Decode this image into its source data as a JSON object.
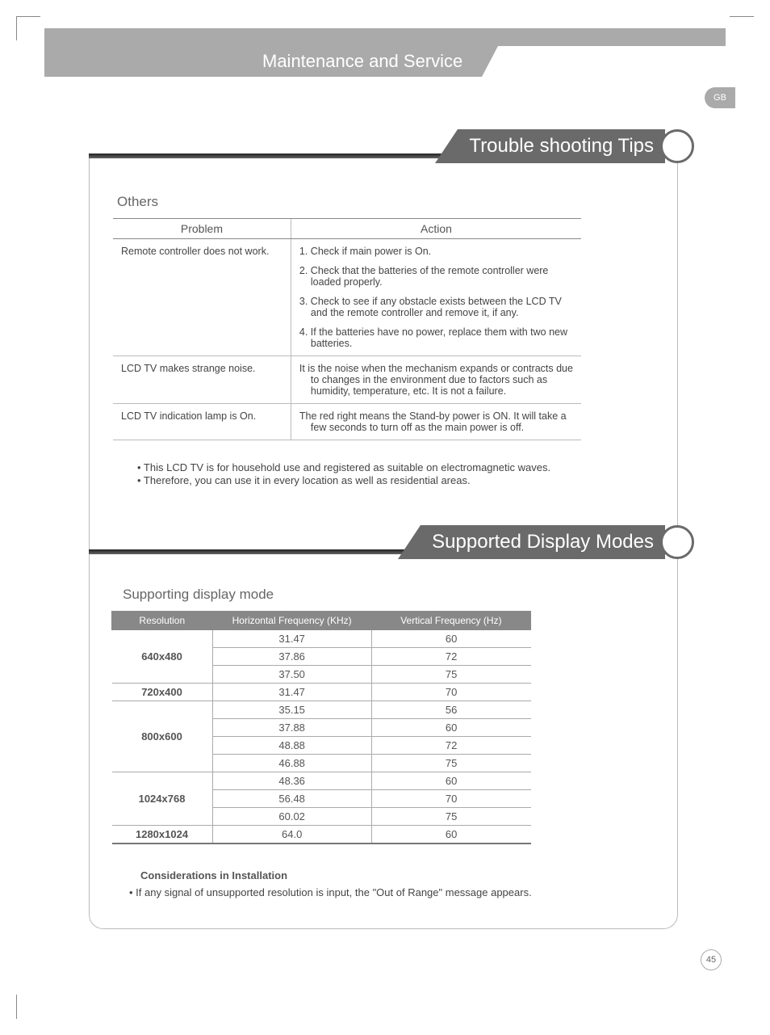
{
  "language_badge": "GB",
  "section_title": "Maintenance and Service",
  "heading1": "Trouble shooting Tips",
  "heading2": "Supported Display Modes",
  "trouble": {
    "subhead": "Others",
    "col_problem": "Problem",
    "col_action": "Action",
    "rows": [
      {
        "problem": "Remote controller does not work.",
        "actions": [
          "1. Check if main power is On.",
          "2. Check that the batteries of the remote controller were loaded properly.",
          "3. Check to see if any obstacle exists between the LCD TV and the remote controller and remove it, if any.",
          "4. If the batteries have no power, replace them with two new batteries."
        ]
      },
      {
        "problem": "LCD TV makes strange noise.",
        "actions": [
          "It is the noise when the mechanism expands or contracts due to changes in the environment due to factors such as humidity, temperature, etc. It is not a failure."
        ]
      },
      {
        "problem": "LCD TV indication lamp is On.",
        "actions": [
          "The red right means the Stand-by power is ON. It will take a few seconds to turn off as the main power is off."
        ]
      }
    ],
    "note1": "• This LCD TV is for household use and registered as suitable on electromagnetic waves.",
    "note2": "• Therefore, you can use it in every location as well as residential areas."
  },
  "modes": {
    "subhead": "Supporting display mode",
    "col_res": "Resolution",
    "col_hf": "Horizontal Frequency (KHz)",
    "col_vf": "Vertical Frequency (Hz)",
    "groups": [
      {
        "res": "640x480",
        "rows": [
          {
            "hf": "31.47",
            "vf": "60"
          },
          {
            "hf": "37.86",
            "vf": "72"
          },
          {
            "hf": "37.50",
            "vf": "75"
          }
        ]
      },
      {
        "res": "720x400",
        "rows": [
          {
            "hf": "31.47",
            "vf": "70"
          }
        ]
      },
      {
        "res": "800x600",
        "rows": [
          {
            "hf": "35.15",
            "vf": "56"
          },
          {
            "hf": "37.88",
            "vf": "60"
          },
          {
            "hf": "48.88",
            "vf": "72"
          },
          {
            "hf": "46.88",
            "vf": "75"
          }
        ]
      },
      {
        "res": "1024x768",
        "rows": [
          {
            "hf": "48.36",
            "vf": "60"
          },
          {
            "hf": "56.48",
            "vf": "70"
          },
          {
            "hf": "60.02",
            "vf": "75"
          }
        ]
      },
      {
        "res": "1280x1024",
        "rows": [
          {
            "hf": "64.0",
            "vf": "60"
          }
        ]
      }
    ]
  },
  "considerations": {
    "title": "Considerations in Installation",
    "line1": "• If any signal of unsupported resolution is input, the \"Out of Range\" message appears."
  },
  "page_number": "45"
}
